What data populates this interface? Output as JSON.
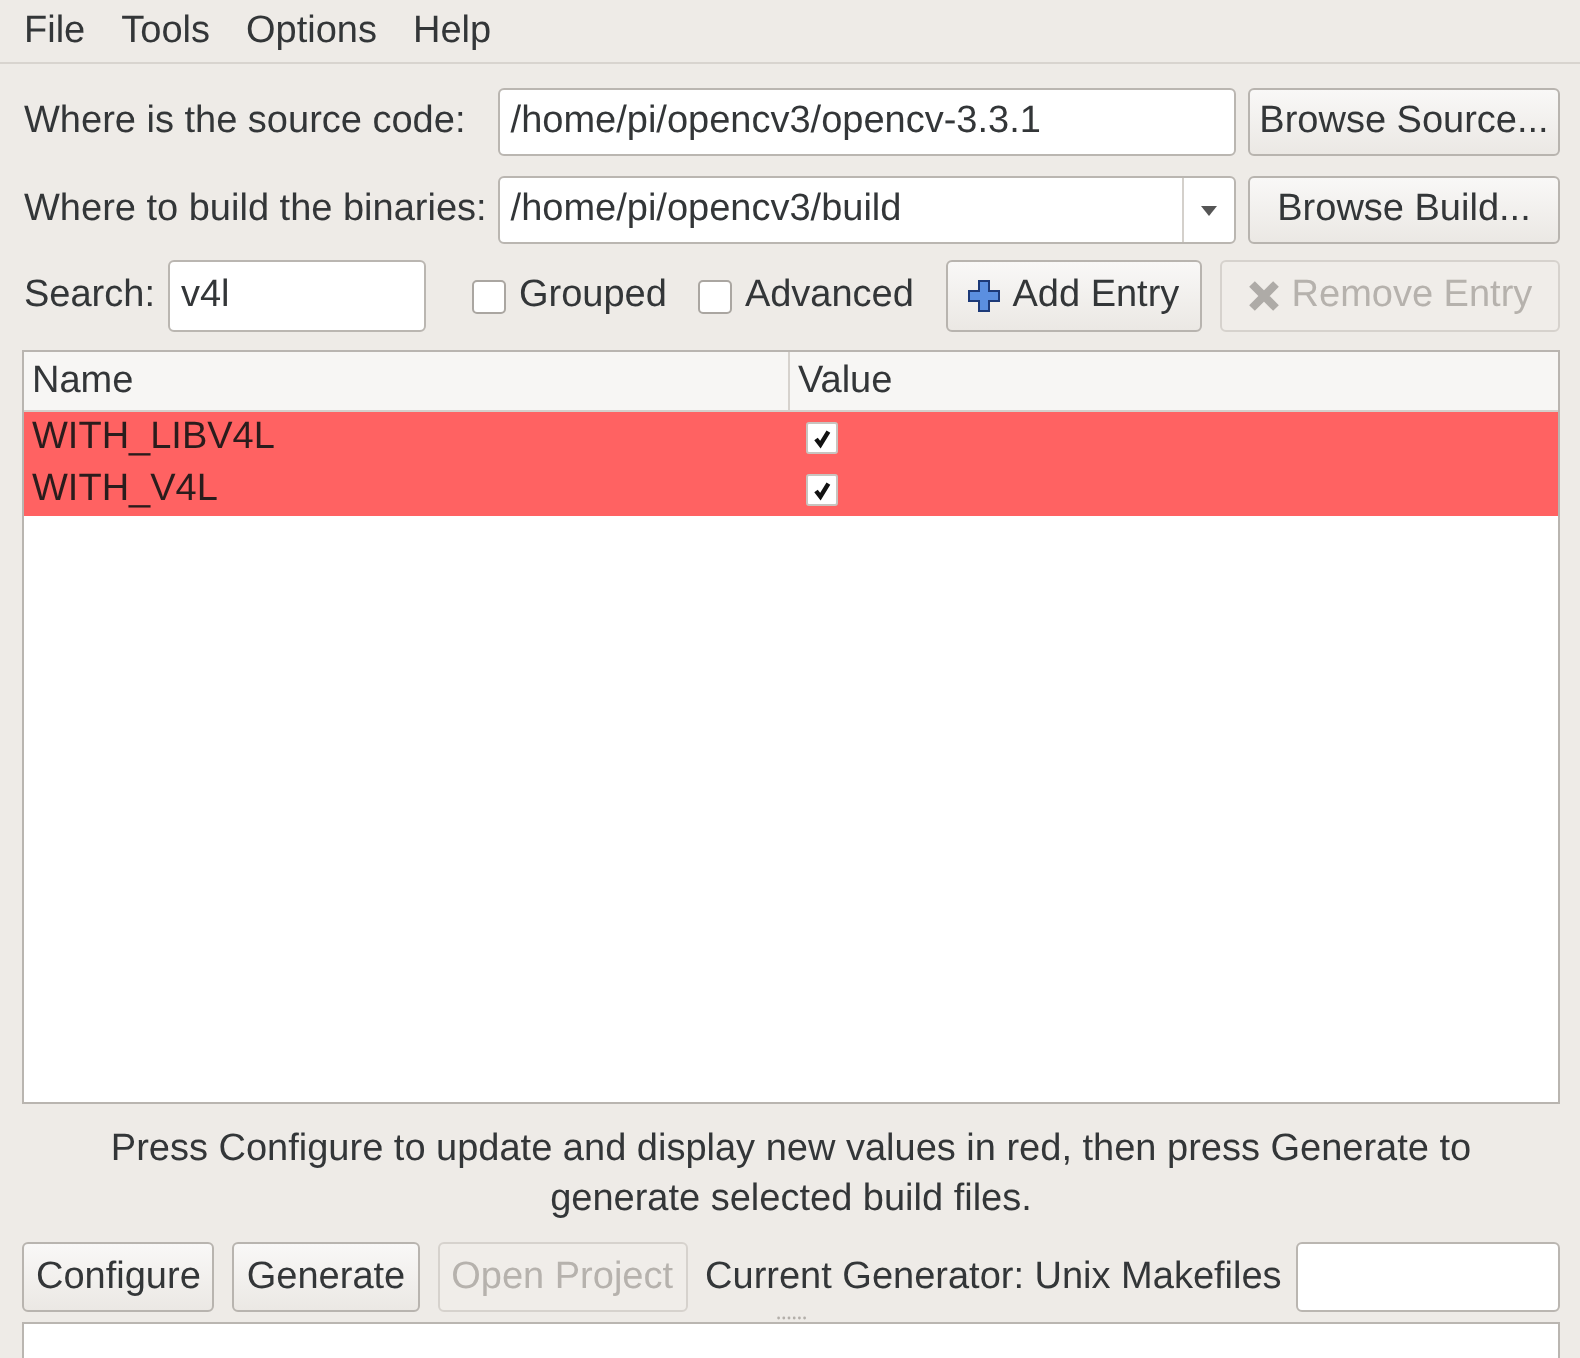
{
  "menu": [
    {
      "label": "File"
    },
    {
      "label": "Tools"
    },
    {
      "label": "Options"
    },
    {
      "label": "Help"
    }
  ],
  "source": {
    "label": "Where is the source code:",
    "value": "/home/pi/opencv3/opencv-3.3.1",
    "button": {
      "label": "Browse Source..."
    }
  },
  "build": {
    "label": "Where to build the binaries:",
    "value": "/home/pi/opencv3/build",
    "button": {
      "label": "Browse Build..."
    }
  },
  "search": {
    "label": "Search:",
    "value": "v4l"
  },
  "options": [
    {
      "label": "Grouped",
      "checked": false
    },
    {
      "label": "Advanced",
      "checked": false
    }
  ],
  "entry_buttons": [
    {
      "kind": "add",
      "label": "Add Entry",
      "disabled": false
    },
    {
      "kind": "remove",
      "label": "Remove Entry",
      "disabled": true
    }
  ],
  "table": {
    "columns": [
      "Name",
      "Value"
    ],
    "rows": [
      {
        "name": "WITH_LIBV4L",
        "checked": true,
        "new": true
      },
      {
        "name": "WITH_V4L",
        "checked": true,
        "new": true
      }
    ]
  },
  "hint": "Press Configure to update and display new values in red, then press Generate to generate selected build files.",
  "actions": [
    {
      "label": "Configure",
      "disabled": false
    },
    {
      "label": "Generate",
      "disabled": false
    },
    {
      "label": "Open Project",
      "disabled": true
    }
  ],
  "generator": {
    "label": "Current Generator: Unix Makefiles"
  }
}
